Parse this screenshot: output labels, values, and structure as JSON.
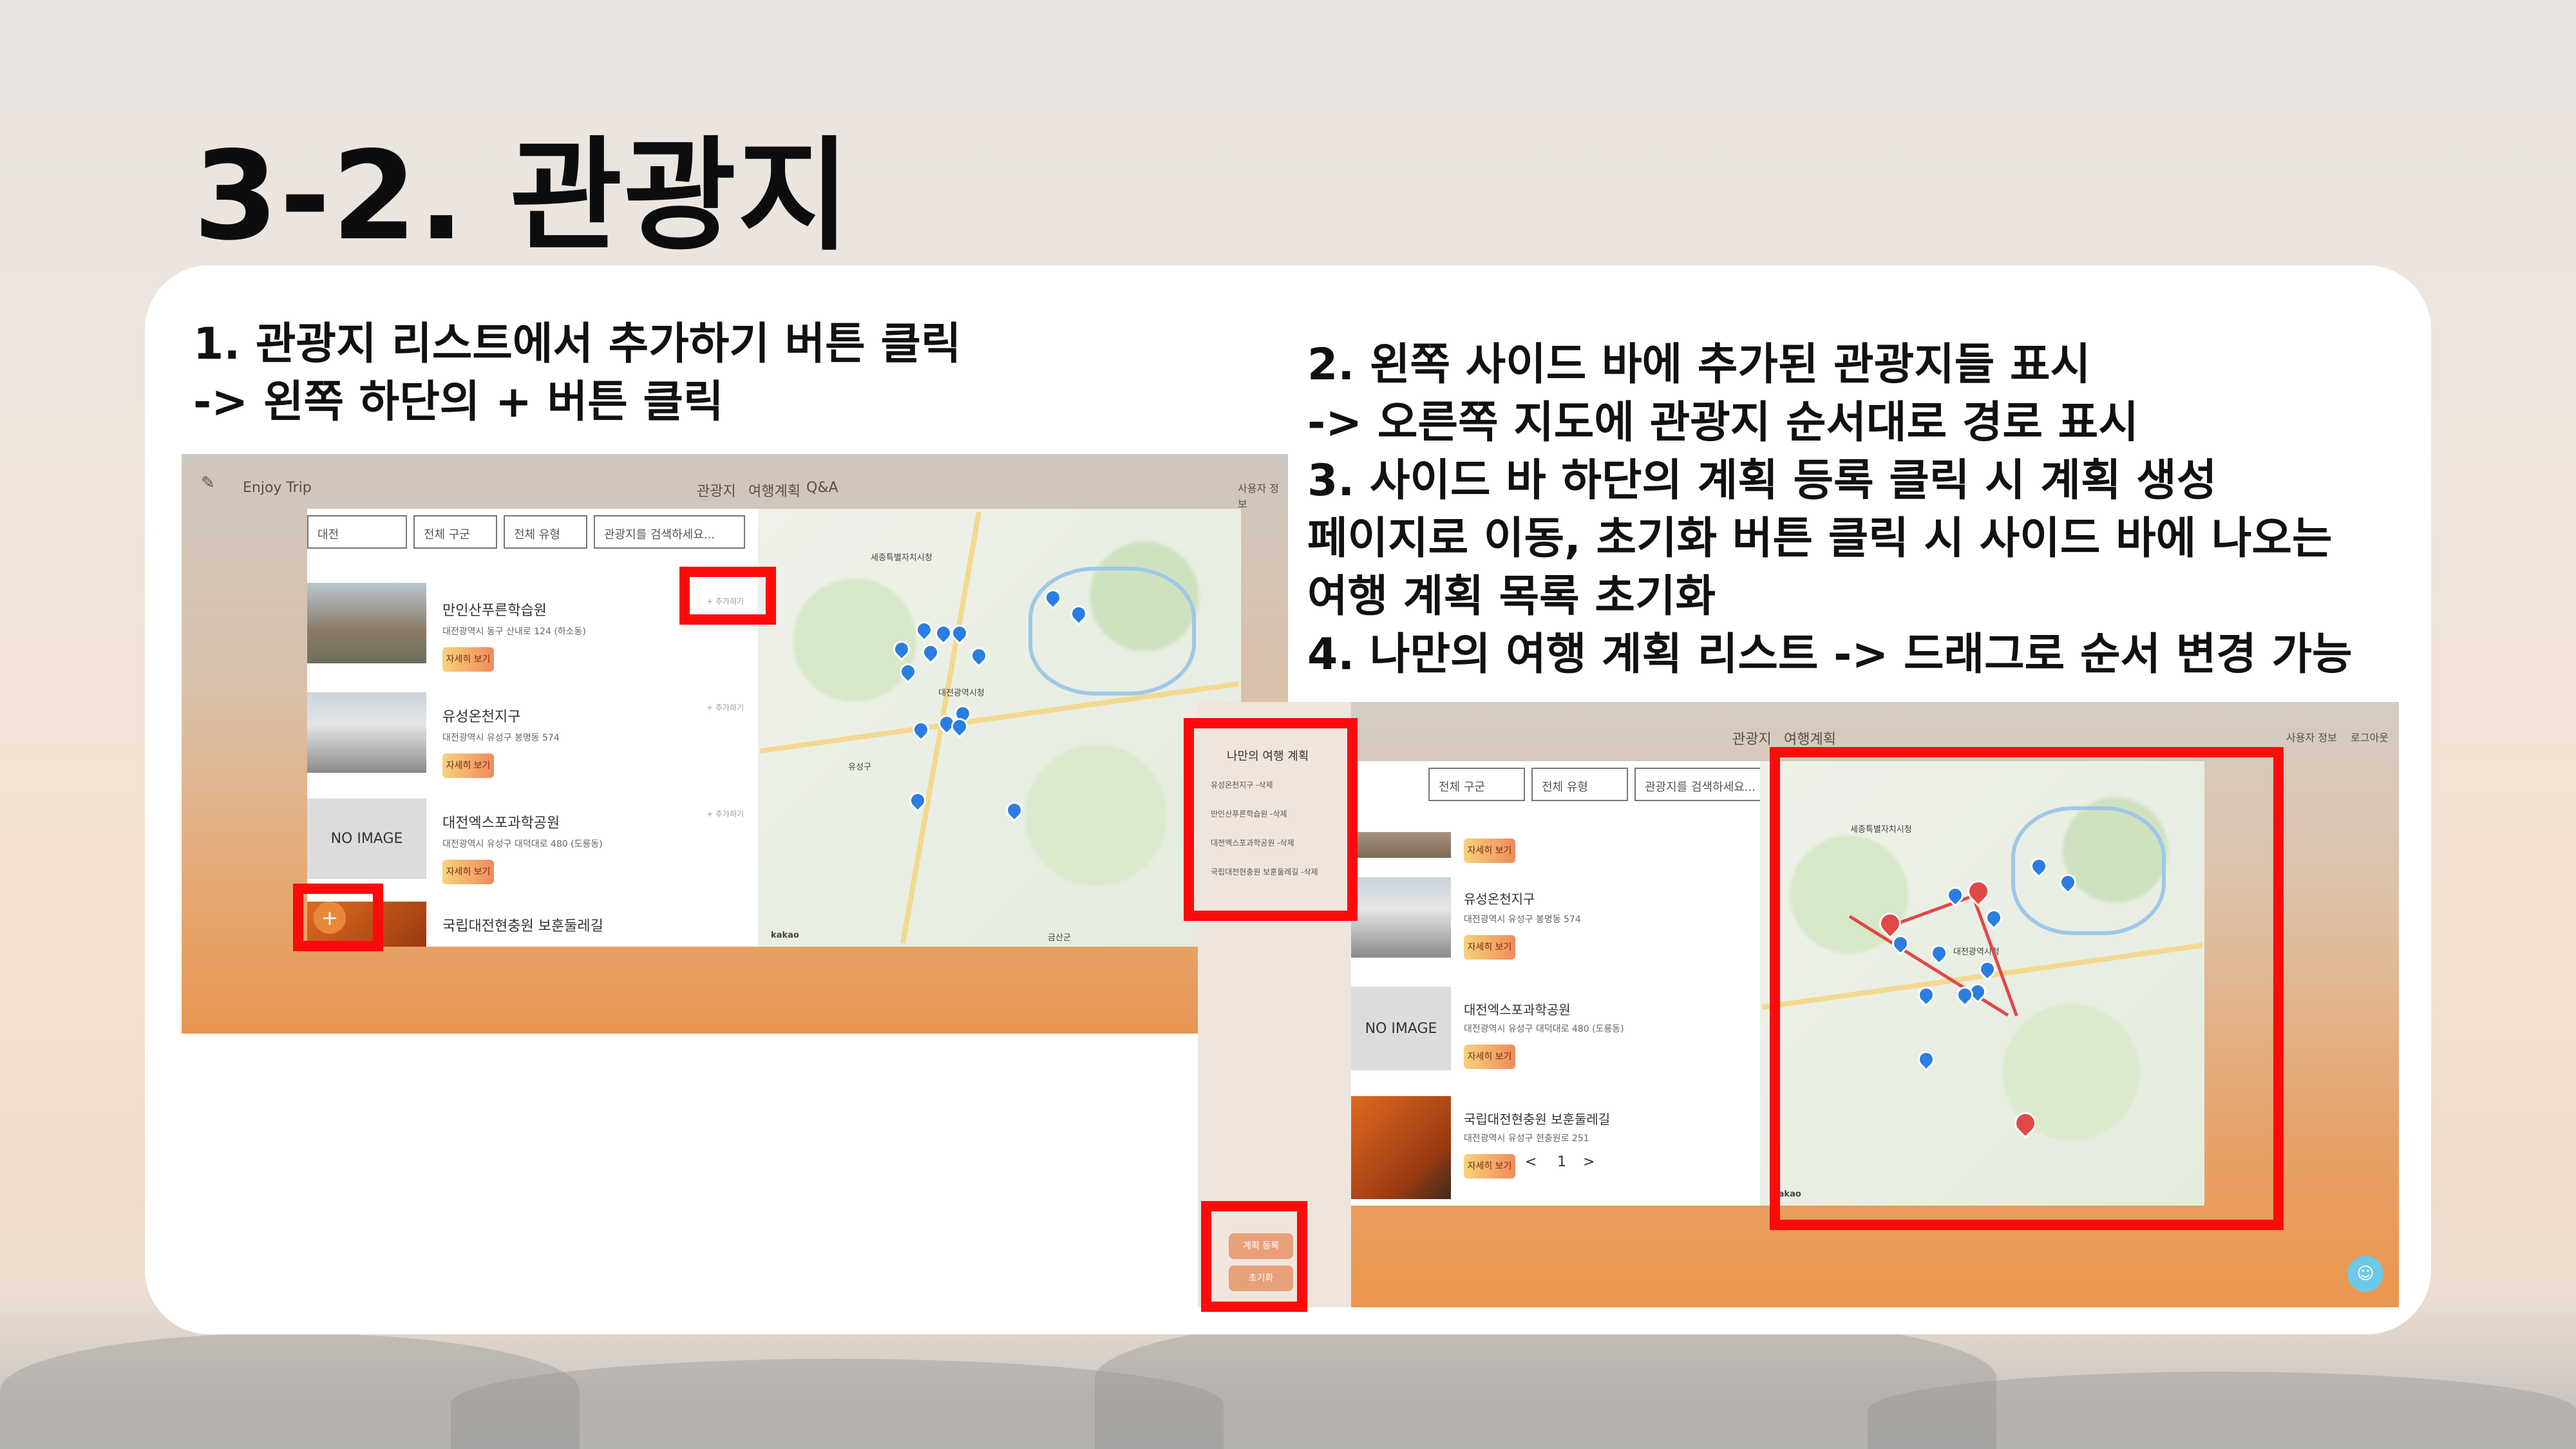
{
  "slide": {
    "title": "3-2. 관광지",
    "step1": [
      "1. 관광지 리스트에서 추가하기 버튼 클릭",
      "-> 왼쪽 하단의 + 버튼 클릭"
    ],
    "step2": [
      "2. 왼쪽 사이드 바에 추가된 관광지들 표시",
      "-> 오른쪽 지도에 관광지 순서대로 경로 표시",
      "3. 사이드 바 하단의 계획 등록 클릭 시 계획 생성",
      "페이지로 이동, 초기화 버튼 클릭 시 사이드 바에 나오는",
      "여행 계획 목록 초기화",
      "4. 나만의 여행 계획 리스트 -> 드래그로 순서 변경 가능"
    ]
  },
  "colors": {
    "highlight": "#ff0a0a",
    "button_gradient_start": "#f6d37a",
    "button_gradient_end": "#f08a5c"
  },
  "shot1": {
    "logo": "Enjoy Trip",
    "nav": [
      "관광지",
      "여행계획",
      "Q&A"
    ],
    "user": "사용자 정보",
    "tabs": [
      "대전",
      "전체 구군",
      "전체 유형",
      "관광지를 검색하세요..."
    ],
    "items": [
      {
        "title": "만인산푸른학습원",
        "addr": "대전광역시 동구 산내로 124 (하소동)",
        "btn": "자세히 보기",
        "link": "+ 추가하기"
      },
      {
        "title": "유성온천지구",
        "addr": "대전광역시 유성구 봉명동 574",
        "btn": "자세히 보기",
        "link": "+ 추가하기"
      },
      {
        "title": "대전엑스포과학공원",
        "addr": "대전광역시 유성구 대덕대로 480 (도룡동)",
        "btn": "자세히 보기",
        "link": "+ 추가하기",
        "noimage": "NO IMAGE"
      },
      {
        "title": "국립대전현충원 보훈둘레길",
        "addr": "",
        "btn": "",
        "link": ""
      }
    ],
    "map_labels": [
      "세종특별자치시청",
      "대전광역시청",
      "유성구",
      "금산군"
    ],
    "kakao": "kakao",
    "plus_button": "+"
  },
  "shot2": {
    "nav": [
      "관광지",
      "여행계획"
    ],
    "user": [
      "사용자 정보",
      "로그아웃"
    ],
    "tabs": [
      "전체 구군",
      "전체 유형",
      "관광지를 검색하세요..."
    ],
    "plan_title": "나만의 여행 계획",
    "plan_items": [
      "유성온천지구 -삭제",
      "만인산푸른학습원 -삭제",
      "대전엑스포과학공원 -삭제",
      "국립대전현충원 보훈둘레길 -삭제"
    ],
    "plan_buttons": [
      "계획 등록",
      "초기화"
    ],
    "items": [
      {
        "title": "",
        "btn": "자세히 보기"
      },
      {
        "title": "유성온천지구",
        "addr": "대전광역시 유성구 봉명동 574",
        "btn": "자세히 보기"
      },
      {
        "title": "대전엑스포과학공원",
        "addr": "대전광역시 유성구 대덕대로 480 (도룡동)",
        "btn": "자세히 보기",
        "noimage": "NO IMAGE"
      },
      {
        "title": "국립대전현충원 보훈둘레길",
        "addr": "대전광역시 유성구 현충원로 251",
        "btn": "자세히 보기"
      }
    ],
    "pagination": [
      "<",
      "1",
      ">"
    ],
    "map_labels": [
      "세종특별자치시청",
      "대전광역시청"
    ],
    "kakao": "kakao"
  },
  "icons": [
    "plus-icon",
    "map-pin-icon",
    "chat-icon",
    "logo-icon"
  ]
}
